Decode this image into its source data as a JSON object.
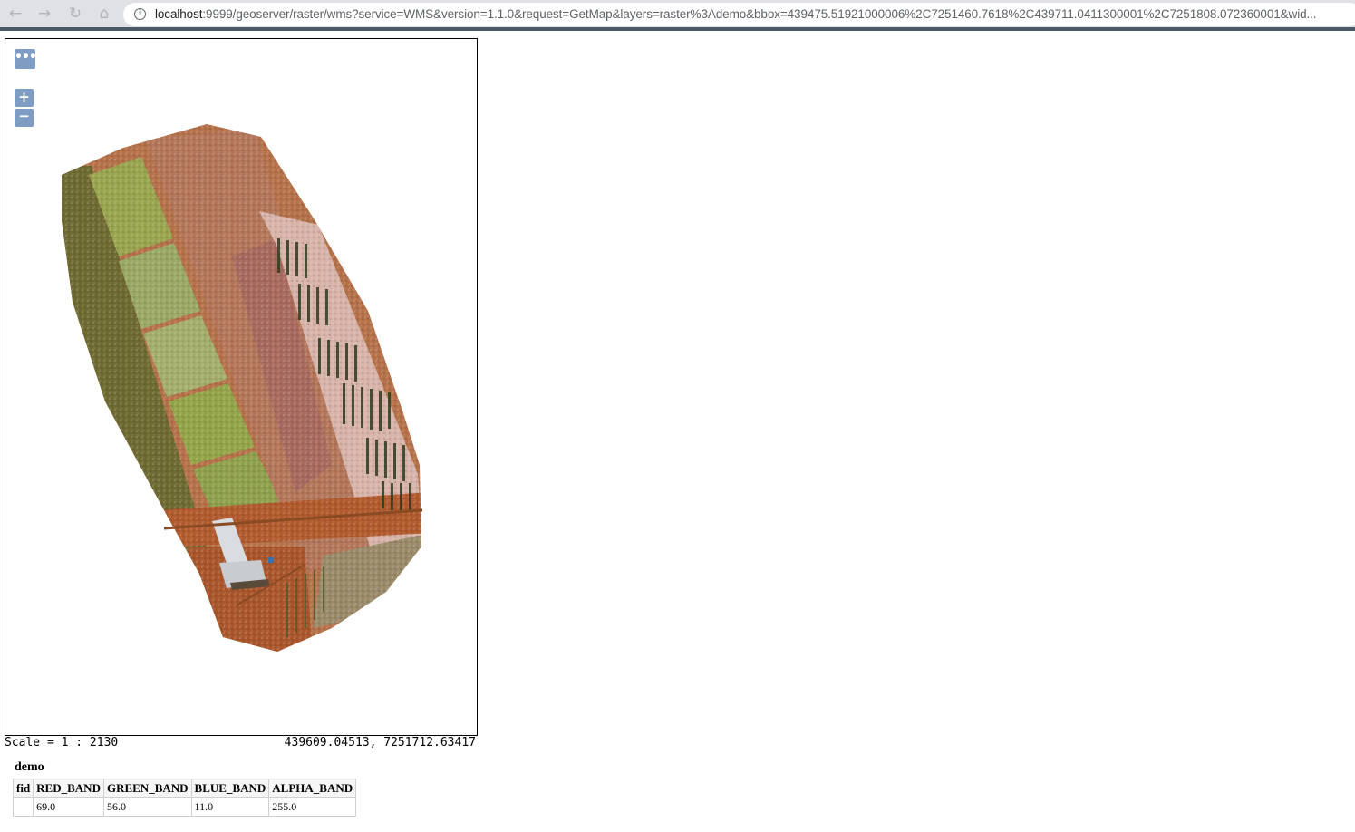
{
  "browser": {
    "url_host": "localhost",
    "url_rest": ":9999/geoserver/raster/wms?service=WMS&version=1.1.0&request=GetMap&layers=raster%3Ademo&bbox=439475.51921000006%2C7251460.7618%2C439711.0411300001%2C7251808.072360001&wid..."
  },
  "map": {
    "layer_switcher_label": "•••",
    "zoom_in_label": "+",
    "zoom_out_label": "−"
  },
  "scale": "Scale = 1 : 2130",
  "mouse_position": "439609.04513, 7251712.63417",
  "feature_info": {
    "layer_title": "demo",
    "columns": [
      "fid",
      "RED_BAND",
      "GREEN_BAND",
      "BLUE_BAND",
      "ALPHA_BAND"
    ],
    "rows": [
      [
        "",
        "69.0",
        "56.0",
        "11.0",
        "255.0"
      ]
    ]
  },
  "colors": {
    "control_bg": "#7b95b8",
    "map_border": "#000000",
    "field_green": "#8ea04c",
    "field_red": "#b07a5c"
  }
}
